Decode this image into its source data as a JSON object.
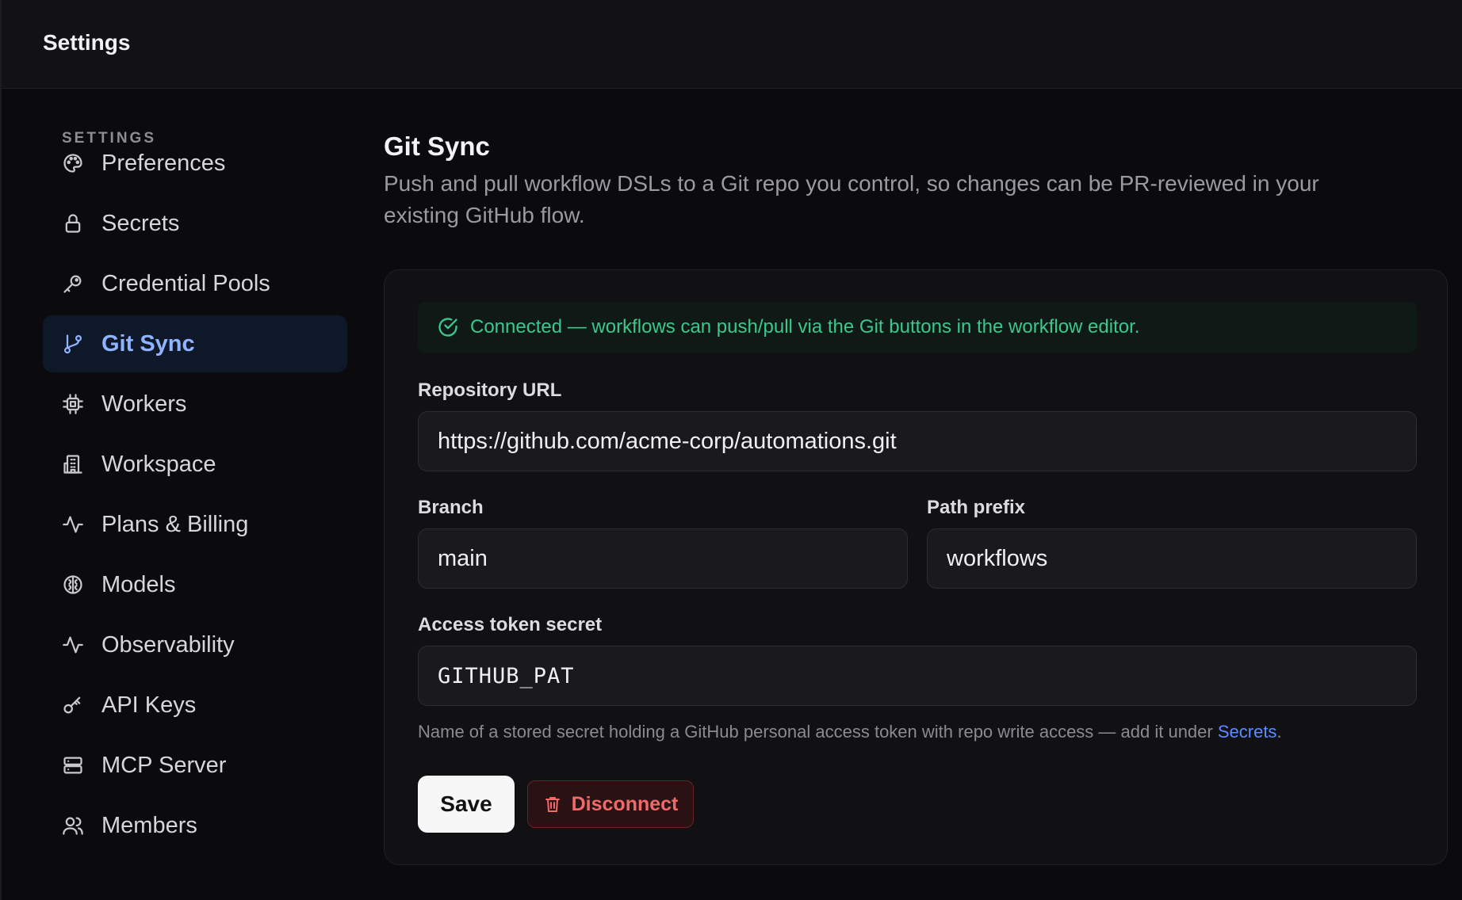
{
  "topbar": {
    "title": "Settings"
  },
  "sidebar": {
    "heading": "SETTINGS",
    "items": [
      {
        "label": "Preferences",
        "icon": "palette-icon"
      },
      {
        "label": "Secrets",
        "icon": "lock-icon"
      },
      {
        "label": "Credential Pools",
        "icon": "key-round-icon"
      },
      {
        "label": "Git Sync",
        "icon": "git-branch-icon",
        "active": true
      },
      {
        "label": "Workers",
        "icon": "cpu-icon"
      },
      {
        "label": "Workspace",
        "icon": "building-icon"
      },
      {
        "label": "Plans & Billing",
        "icon": "activity-icon"
      },
      {
        "label": "Models",
        "icon": "brain-icon"
      },
      {
        "label": "Observability",
        "icon": "activity-icon"
      },
      {
        "label": "API Keys",
        "icon": "key-icon"
      },
      {
        "label": "MCP Server",
        "icon": "server-icon"
      },
      {
        "label": "Members",
        "icon": "users-icon"
      }
    ]
  },
  "main": {
    "title": "Git Sync",
    "description": "Push and pull workflow DSLs to a Git repo you control, so changes can be PR-reviewed in your existing GitHub flow.",
    "banner": "Connected — workflows can push/pull via the Git buttons in the workflow editor.",
    "repo": {
      "label": "Repository URL",
      "value": "https://github.com/acme-corp/automations.git"
    },
    "branch": {
      "label": "Branch",
      "value": "main"
    },
    "path_prefix": {
      "label": "Path prefix",
      "value": "workflows"
    },
    "token": {
      "label": "Access token secret",
      "value": "GITHUB_PAT"
    },
    "help_text": "Name of a stored secret holding a GitHub personal access token with repo write access — add it under ",
    "help_link": "Secrets",
    "help_suffix": ".",
    "save_label": "Save",
    "disconnect_label": "Disconnect"
  },
  "colors": {
    "accent": "#8fb3ff",
    "success": "#3cc88c",
    "danger": "#f06a6a",
    "link": "#5b8cff"
  }
}
